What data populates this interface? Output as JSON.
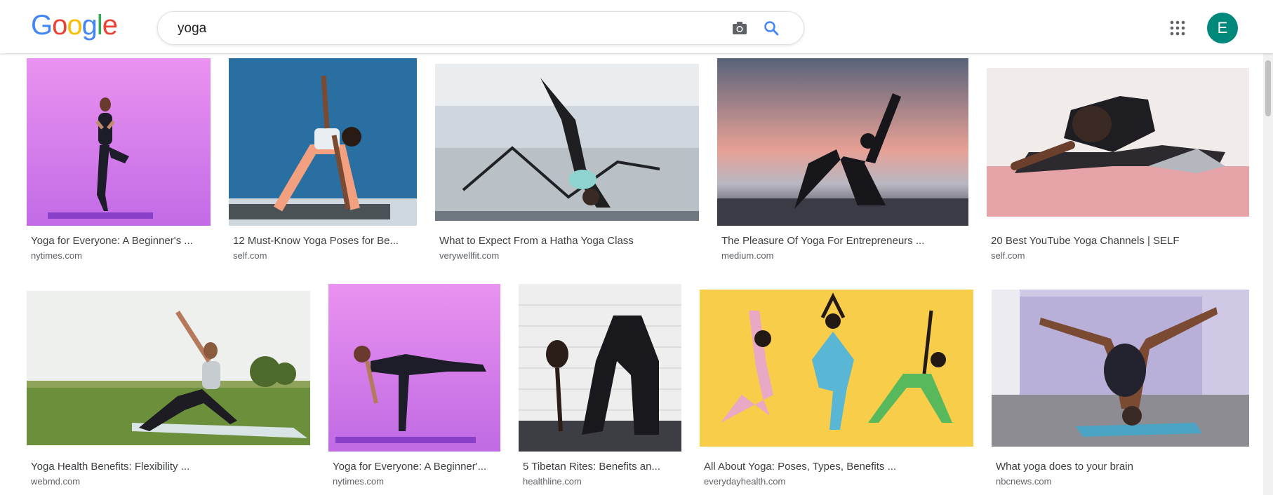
{
  "header": {
    "logo_letters": [
      "G",
      "o",
      "o",
      "g",
      "l",
      "e"
    ],
    "search_value": "yoga",
    "camera_icon": "camera-icon",
    "search_icon": "search-icon",
    "apps_icon": "apps-grid-icon",
    "avatar_letter": "E"
  },
  "results": {
    "row1": [
      {
        "caption": "Yoga for Everyone: A Beginner's ...",
        "source": "nytimes.com"
      },
      {
        "caption": "12 Must-Know Yoga Poses for Be...",
        "source": "self.com"
      },
      {
        "caption": "What to Expect From a Hatha Yoga Class",
        "source": "verywellfit.com"
      },
      {
        "caption": "The Pleasure Of Yoga For Entrepreneurs ...",
        "source": "medium.com"
      },
      {
        "caption": "20 Best YouTube Yoga Channels | SELF",
        "source": "self.com"
      }
    ],
    "row2": [
      {
        "caption": "Yoga Health Benefits: Flexibility ...",
        "source": "webmd.com"
      },
      {
        "caption": "Yoga for Everyone: A Beginner'...",
        "source": "nytimes.com"
      },
      {
        "caption": "5 Tibetan Rites: Benefits an...",
        "source": "healthline.com"
      },
      {
        "caption": "All About Yoga: Poses, Types, Benefits ...",
        "source": "everydayhealth.com"
      },
      {
        "caption": "What yoga does to your brain",
        "source": "nbcnews.com"
      }
    ]
  },
  "colors": {
    "avatar_bg": "#00897b",
    "link_blue": "#4285F4"
  }
}
